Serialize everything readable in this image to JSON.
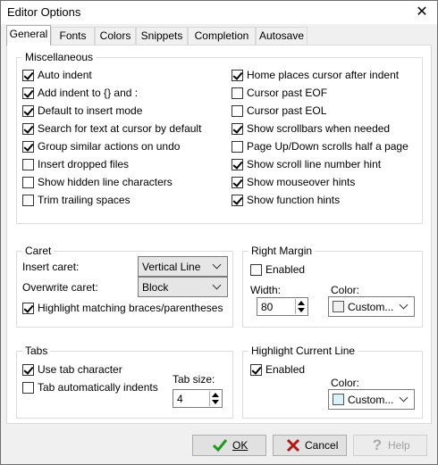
{
  "window": {
    "title": "Editor Options"
  },
  "tabs": [
    "General",
    "Fonts",
    "Colors",
    "Snippets",
    "Completion",
    "Autosave"
  ],
  "active_tab": "General",
  "misc": {
    "title": "Miscellaneous",
    "left": [
      {
        "label": "Auto indent",
        "checked": true
      },
      {
        "label": "Add indent to {} and :",
        "checked": true
      },
      {
        "label": "Default to insert mode",
        "checked": true
      },
      {
        "label": "Search for text at cursor by default",
        "checked": true
      },
      {
        "label": "Group similar actions on undo",
        "checked": true
      },
      {
        "label": "Insert dropped files",
        "checked": false
      },
      {
        "label": "Show hidden line characters",
        "checked": false
      },
      {
        "label": "Trim trailing spaces",
        "checked": false
      }
    ],
    "right": [
      {
        "label": "Home places cursor after indent",
        "checked": true
      },
      {
        "label": "Cursor past EOF",
        "checked": false
      },
      {
        "label": "Cursor past EOL",
        "checked": false
      },
      {
        "label": "Show scrollbars when needed",
        "checked": true
      },
      {
        "label": "Page Up/Down scrolls half a page",
        "checked": false
      },
      {
        "label": "Show scroll line number hint",
        "checked": true
      },
      {
        "label": "Show mouseover hints",
        "checked": true
      },
      {
        "label": "Show function hints",
        "checked": true
      }
    ]
  },
  "caret": {
    "title": "Caret",
    "insert_label": "Insert caret:",
    "insert_value": "Vertical Line",
    "overwrite_label": "Overwrite caret:",
    "overwrite_value": "Block",
    "highlight_label": "Highlight matching braces/parentheses",
    "highlight_checked": true
  },
  "right_margin": {
    "title": "Right Margin",
    "enabled_label": "Enabled",
    "enabled": false,
    "width_label": "Width:",
    "width_value": "80",
    "color_label": "Color:",
    "color_value": "Custom...",
    "swatch_color": "#f0f0f0"
  },
  "tabs_group": {
    "title": "Tabs",
    "use_tab_label": "Use tab character",
    "use_tab": true,
    "auto_indent_label": "Tab automatically indents",
    "auto_indent": false,
    "tab_size_label": "Tab size:",
    "tab_size_value": "4"
  },
  "highlight_line": {
    "title": "Highlight Current Line",
    "enabled_label": "Enabled",
    "enabled": true,
    "color_label": "Color:",
    "color_value": "Custom...",
    "swatch_color": "#d8f2f8"
  },
  "buttons": {
    "ok": "OK",
    "cancel": "Cancel",
    "help": "Help"
  },
  "icons": {
    "ok": "check-icon",
    "cancel": "x-icon",
    "help": "question-icon"
  },
  "colors": {
    "ok_green": "#1a9b1a",
    "cancel_red": "#b01818",
    "help_disabled": "#a8a8a8"
  }
}
